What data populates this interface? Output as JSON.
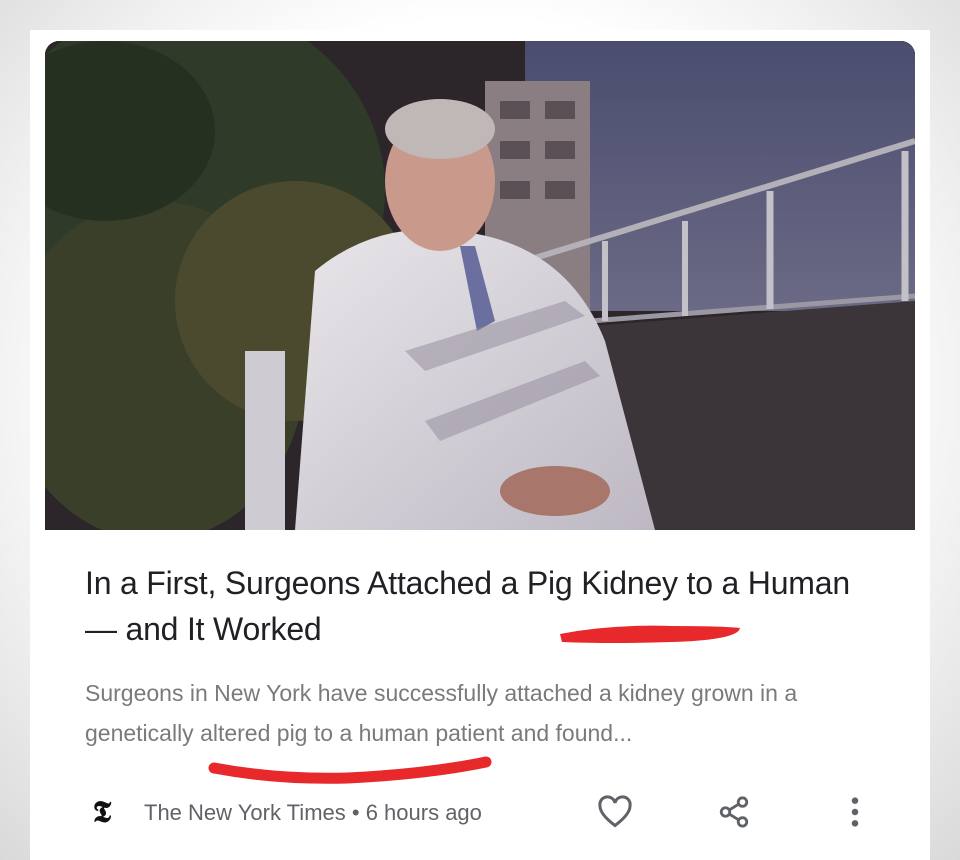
{
  "article": {
    "headline": "In a First, Surgeons Attached a Pig Kidney to a Human — and It Worked",
    "snippet": "Surgeons in New York have successfully attached a kidney grown in a genetically altered pig to a human patient and found...",
    "source": "The New York Times",
    "separator": "•",
    "time_ago": "6 hours ago"
  },
  "icons": {
    "publisher_logo": "nyt-logo-icon",
    "like": "heart-icon",
    "share": "share-icon",
    "more": "more-vert-icon"
  },
  "colors": {
    "headline": "#202124",
    "snippet": "#7a7a7a",
    "meta": "#5f6368",
    "annotation": "#e8292c"
  }
}
